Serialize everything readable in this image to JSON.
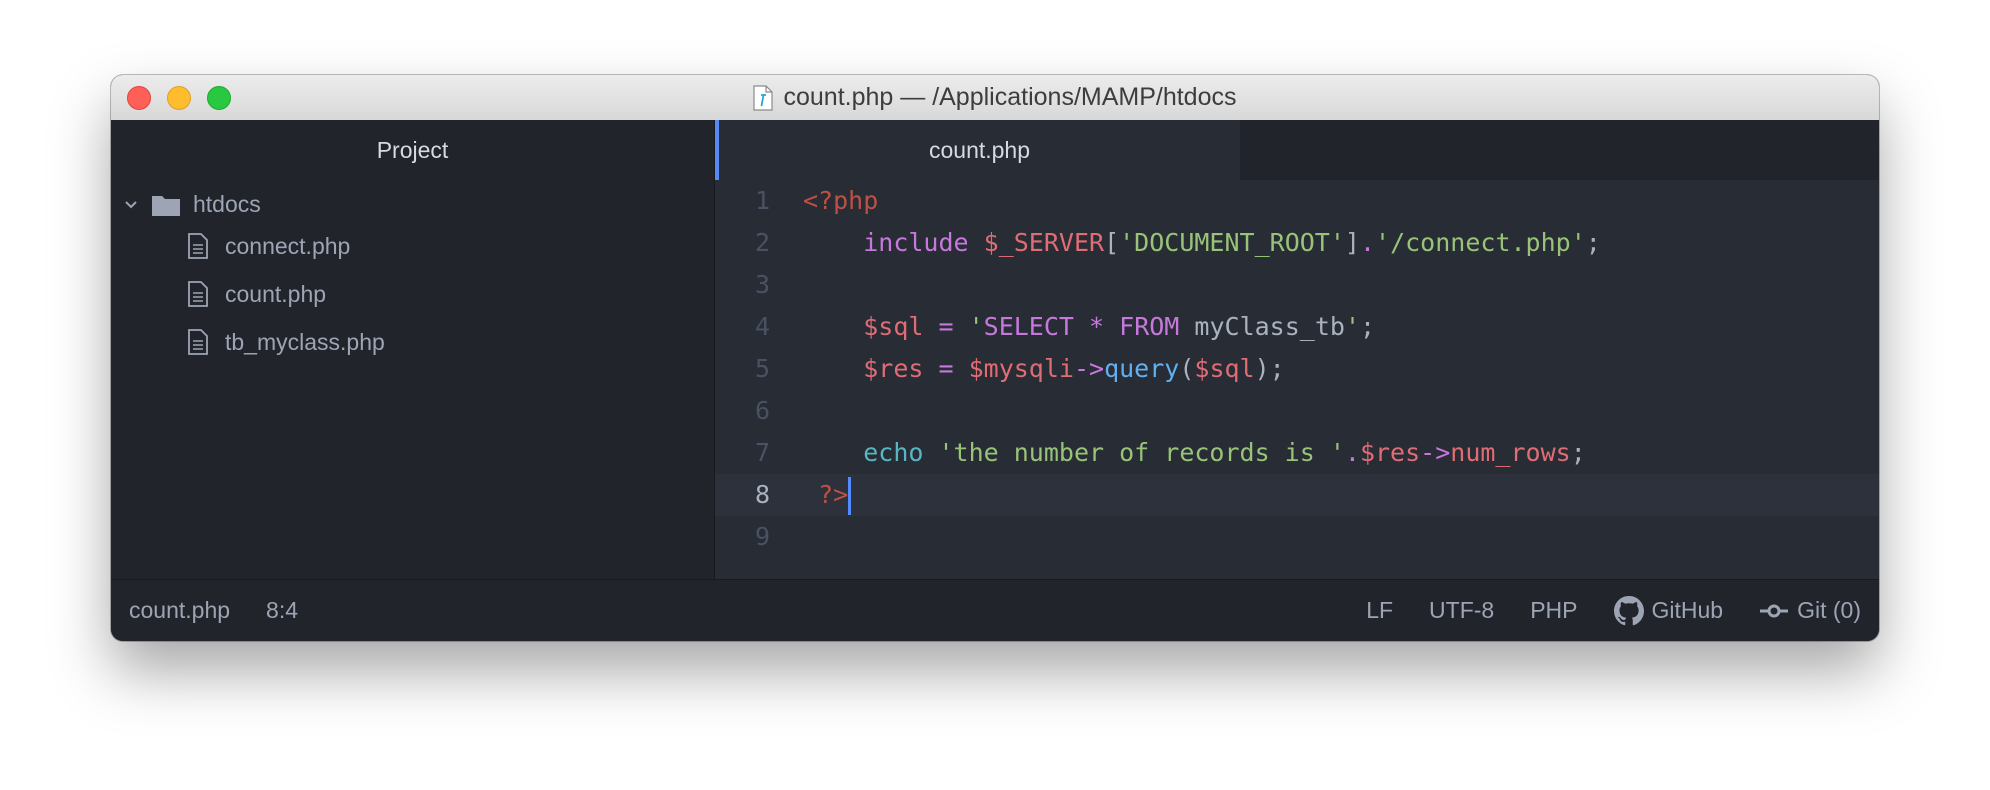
{
  "window": {
    "title": "count.php — /Applications/MAMP/htdocs"
  },
  "sidebar": {
    "header": "Project",
    "root_folder": "htdocs",
    "files": [
      "connect.php",
      "count.php",
      "tb_myclass.php"
    ]
  },
  "editor": {
    "active_tab": "count.php",
    "current_line": 8,
    "line_numbers": [
      "1",
      "2",
      "3",
      "4",
      "5",
      "6",
      "7",
      "8",
      "9"
    ],
    "lines": [
      [
        {
          "t": "<?php",
          "c": "c-tag2"
        }
      ],
      [
        {
          "t": "    ",
          "c": "c-plain"
        },
        {
          "t": "include",
          "c": "c-kw"
        },
        {
          "t": " ",
          "c": "c-plain"
        },
        {
          "t": "$_SERVER",
          "c": "c-var"
        },
        {
          "t": "[",
          "c": "c-plain"
        },
        {
          "t": "'DOCUMENT_ROOT'",
          "c": "c-str"
        },
        {
          "t": "]",
          "c": "c-plain"
        },
        {
          "t": ".",
          "c": "c-kw"
        },
        {
          "t": "'/connect.php'",
          "c": "c-str"
        },
        {
          "t": ";",
          "c": "c-plain"
        }
      ],
      [],
      [
        {
          "t": "    ",
          "c": "c-plain"
        },
        {
          "t": "$sql",
          "c": "c-var"
        },
        {
          "t": " = ",
          "c": "c-kw"
        },
        {
          "t": "'",
          "c": "c-str"
        },
        {
          "t": "SELECT",
          "c": "c-kw"
        },
        {
          "t": " ",
          "c": "c-plain"
        },
        {
          "t": "*",
          "c": "c-kw"
        },
        {
          "t": " ",
          "c": "c-plain"
        },
        {
          "t": "FROM",
          "c": "c-kw"
        },
        {
          "t": " myClass_tb",
          "c": "c-plain"
        },
        {
          "t": "'",
          "c": "c-str"
        },
        {
          "t": ";",
          "c": "c-plain"
        }
      ],
      [
        {
          "t": "    ",
          "c": "c-plain"
        },
        {
          "t": "$res",
          "c": "c-var"
        },
        {
          "t": " = ",
          "c": "c-kw"
        },
        {
          "t": "$mysqli",
          "c": "c-var"
        },
        {
          "t": "->",
          "c": "c-kw"
        },
        {
          "t": "query",
          "c": "c-fn"
        },
        {
          "t": "(",
          "c": "c-plain"
        },
        {
          "t": "$sql",
          "c": "c-var"
        },
        {
          "t": ");",
          "c": "c-plain"
        }
      ],
      [],
      [
        {
          "t": "    ",
          "c": "c-plain"
        },
        {
          "t": "echo",
          "c": "c-echo"
        },
        {
          "t": " ",
          "c": "c-plain"
        },
        {
          "t": "'the number of records is '",
          "c": "c-str"
        },
        {
          "t": ".",
          "c": "c-kw"
        },
        {
          "t": "$res",
          "c": "c-var"
        },
        {
          "t": "->",
          "c": "c-kw"
        },
        {
          "t": "num_rows",
          "c": "c-var"
        },
        {
          "t": ";",
          "c": "c-plain"
        }
      ],
      [
        {
          "t": " ",
          "c": "c-plain"
        },
        {
          "t": "?>",
          "c": "c-tag2"
        }
      ],
      []
    ]
  },
  "status": {
    "file": "count.php",
    "cursor": "8:4",
    "line_ending": "LF",
    "encoding": "UTF-8",
    "grammar": "PHP",
    "github": "GitHub",
    "git": "Git (0)"
  },
  "icons": {
    "close": "close-icon",
    "minimize": "minimize-icon",
    "maximize": "maximize-icon",
    "chevron": "chevron-down-icon",
    "folder": "folder-icon",
    "file": "file-text-icon",
    "github": "github-icon",
    "git": "git-commit-icon"
  },
  "colors": {
    "accent": "#568af2",
    "background": "#282c34",
    "panel": "#21252b"
  }
}
